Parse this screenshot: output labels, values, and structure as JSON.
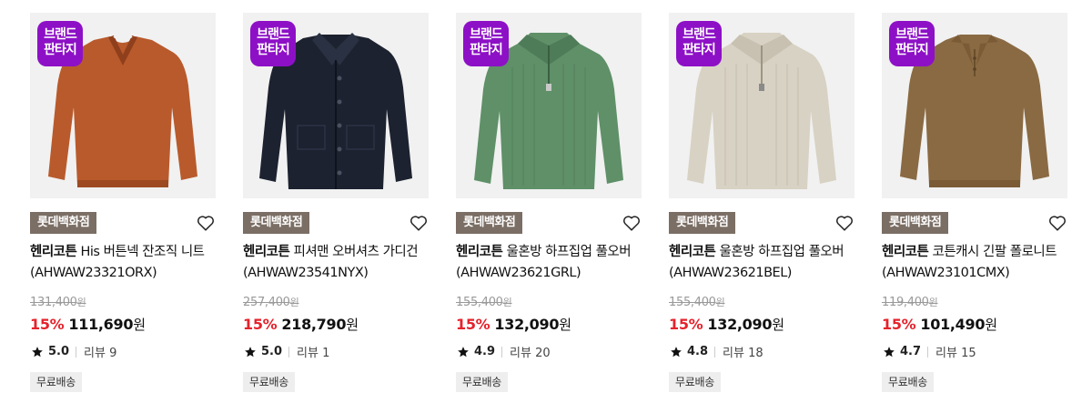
{
  "products": [
    {
      "badge_line1": "브랜드",
      "badge_line2": "판타지",
      "store": "롯데백화점",
      "brand": "헨리코튼",
      "name": " His 버튼넥 잔조직 니트 (AHWAW23321ORX)",
      "original_price": "131,400",
      "original_unit": "원",
      "discount": "15%",
      "price": "111,690",
      "price_unit": "원",
      "rating": "5.0",
      "review_text": "리뷰 9",
      "shipping": "무료배송",
      "image": "rust-orange-polo-knit-sweater"
    },
    {
      "badge_line1": "브랜드",
      "badge_line2": "판타지",
      "store": "롯데백화점",
      "brand": "헨리코튼",
      "name": " 피셔맨 오버셔츠 가디건 (AHWAW23541NYX)",
      "original_price": "257,400",
      "original_unit": "원",
      "discount": "15%",
      "price": "218,790",
      "price_unit": "원",
      "rating": "5.0",
      "review_text": "리뷰 1",
      "shipping": "무료배송",
      "image": "navy-knit-overshirt-cardigan"
    },
    {
      "badge_line1": "브랜드",
      "badge_line2": "판타지",
      "store": "롯데백화점",
      "brand": "헨리코튼",
      "name": " 울혼방 하프집업 풀오버 (AHWAW23621GRL)",
      "original_price": "155,400",
      "original_unit": "원",
      "discount": "15%",
      "price": "132,090",
      "price_unit": "원",
      "rating": "4.9",
      "review_text": "리뷰 20",
      "shipping": "무료배송",
      "image": "green-half-zip-pullover"
    },
    {
      "badge_line1": "브랜드",
      "badge_line2": "판타지",
      "store": "롯데백화점",
      "brand": "헨리코튼",
      "name": " 울혼방 하프집업 풀오버 (AHWAW23621BEL)",
      "original_price": "155,400",
      "original_unit": "원",
      "discount": "15%",
      "price": "132,090",
      "price_unit": "원",
      "rating": "4.8",
      "review_text": "리뷰 18",
      "shipping": "무료배송",
      "image": "beige-half-zip-pullover"
    },
    {
      "badge_line1": "브랜드",
      "badge_line2": "판타지",
      "store": "롯데백화점",
      "brand": "헨리코튼",
      "name": " 코튼캐시 긴팔 폴로니트 (AHWAW23101CMX)",
      "original_price": "119,400",
      "original_unit": "원",
      "discount": "15%",
      "price": "101,490",
      "price_unit": "원",
      "rating": "4.7",
      "review_text": "리뷰 15",
      "shipping": "무료배송",
      "image": "brown-polo-knit-sweater"
    }
  ],
  "colors": {
    "badge_purple": "#8d10c6",
    "store_tag": "#7b6e64",
    "discount_red": "#e4232c",
    "sweater_colors": [
      "#b95a2c",
      "#1d2230",
      "#5f9068",
      "#d8d2c4",
      "#8a6a43"
    ]
  },
  "icons": {
    "wishlist": "heart-outline-icon",
    "rating": "star-icon"
  }
}
